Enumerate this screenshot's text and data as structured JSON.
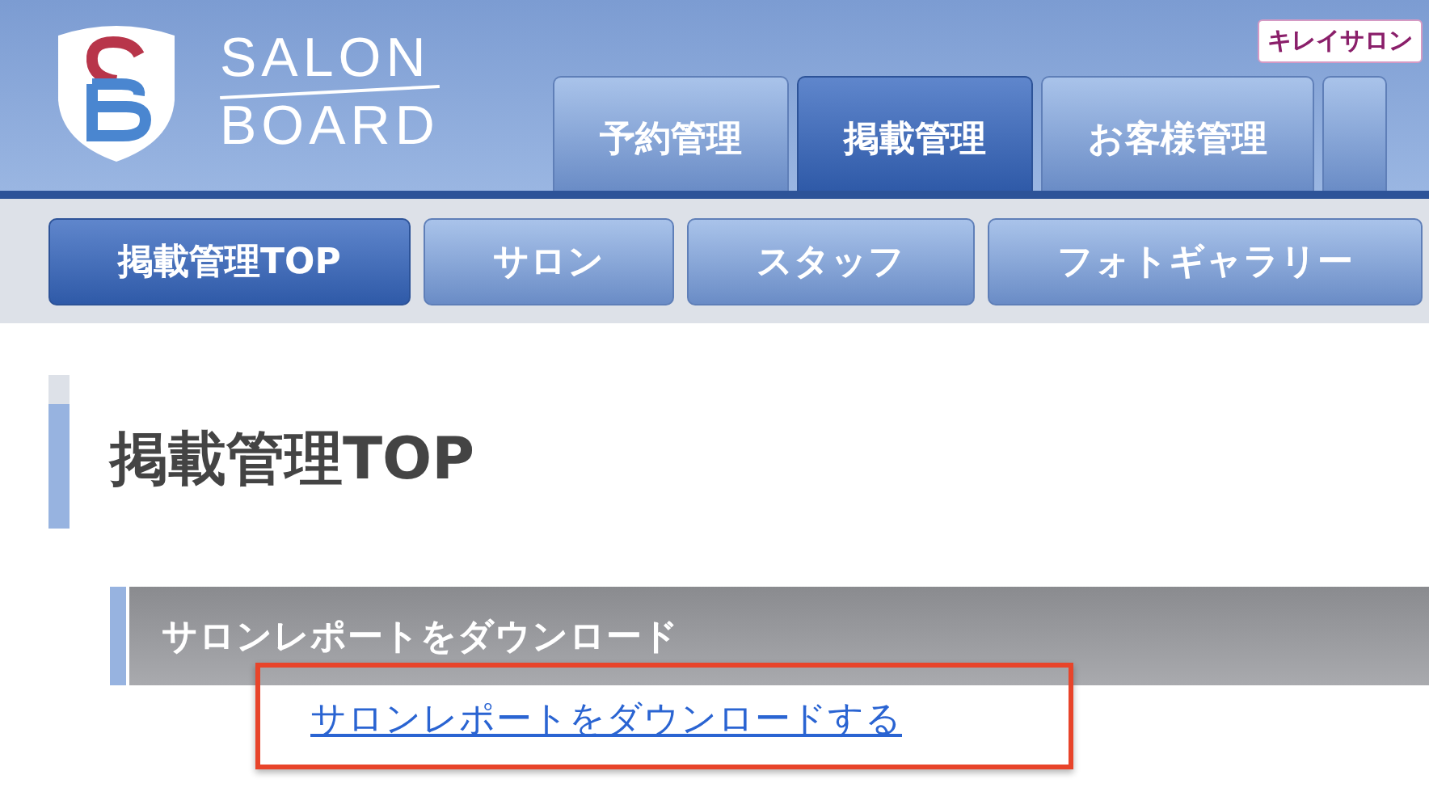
{
  "header": {
    "logo": {
      "line_1": "SALON",
      "line_2": "BOARD"
    },
    "badge": "キレイサロン"
  },
  "tabs": [
    {
      "label": "予約管理",
      "selected": false
    },
    {
      "label": "掲載管理",
      "selected": true
    },
    {
      "label": "お客様管理",
      "selected": false
    }
  ],
  "subnav": [
    {
      "label": "掲載管理TOP",
      "selected": true
    },
    {
      "label": "サロン",
      "selected": false
    },
    {
      "label": "スタッフ",
      "selected": false
    },
    {
      "label": "フォトギャラリー",
      "selected": false
    }
  ],
  "page_title": "掲載管理TOP",
  "section": {
    "title": "サロンレポートをダウンロード",
    "link": "サロンレポートをダウンロードする"
  }
}
